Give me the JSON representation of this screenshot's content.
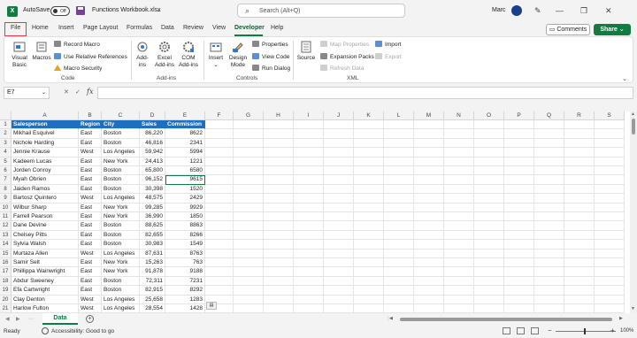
{
  "titlebar": {
    "autosave_label": "AutoSave",
    "autosave_state": "Off",
    "document_title": "Functions Workbook.xlsx",
    "search_placeholder": "Search (Alt+Q)",
    "user_name": "Marc"
  },
  "tabs": [
    "File",
    "Home",
    "Insert",
    "Page Layout",
    "Formulas",
    "Data",
    "Review",
    "View",
    "Developer",
    "Help"
  ],
  "active_tab": "Developer",
  "actions": {
    "comments": "Comments",
    "share": "Share"
  },
  "ribbon": {
    "code": {
      "label": "Code",
      "visual_basic": "Visual Basic",
      "macros": "Macros",
      "record_macro": "Record Macro",
      "use_relative": "Use Relative References",
      "macro_security": "Macro Security"
    },
    "addins": {
      "label": "Add-ins",
      "addins": "Add-ins",
      "excel_addins": "Excel Add-ins",
      "com_addins": "COM Add-ins"
    },
    "controls": {
      "label": "Controls",
      "insert": "Insert",
      "design_mode": "Design Mode",
      "properties": "Properties",
      "view_code": "View Code",
      "run_dialog": "Run Dialog"
    },
    "xml": {
      "label": "XML",
      "source": "Source",
      "map_properties": "Map Properties",
      "expansion_packs": "Expansion Packs",
      "refresh_data": "Refresh Data",
      "import": "Import",
      "export": "Export"
    }
  },
  "formula_bar": {
    "name_box": "E7",
    "formula": ""
  },
  "columns": [
    "A",
    "B",
    "C",
    "D",
    "E",
    "F",
    "G",
    "H",
    "I",
    "J",
    "K",
    "L",
    "M",
    "N",
    "O",
    "P",
    "Q",
    "R",
    "S"
  ],
  "table": {
    "headers": [
      "Salesperson",
      "Region",
      "City",
      "Sales",
      "Commission"
    ],
    "rows": [
      [
        "Mikhail Esquivel",
        "East",
        "Boston",
        "86,220",
        "8622"
      ],
      [
        "Nichole Harding",
        "East",
        "Boston",
        "46,816",
        "2341"
      ],
      [
        "Jennie Krause",
        "West",
        "Los Angeles",
        "59,942",
        "5994"
      ],
      [
        "Kadeem Lucas",
        "East",
        "New York",
        "24,413",
        "1221"
      ],
      [
        "Jorden Conroy",
        "East",
        "Boston",
        "65,800",
        "6580"
      ],
      [
        "Myah Obrien",
        "East",
        "Boston",
        "96,152",
        "9615"
      ],
      [
        "Jaiden Ramos",
        "East",
        "Boston",
        "30,398",
        "1520"
      ],
      [
        "Bartosz Quintero",
        "West",
        "Los Angeles",
        "48,575",
        "2429"
      ],
      [
        "Wilbur Sharp",
        "East",
        "New York",
        "99,285",
        "9929"
      ],
      [
        "Farrell Pearson",
        "East",
        "New York",
        "36,990",
        "1850"
      ],
      [
        "Dane Devine",
        "East",
        "Boston",
        "88,625",
        "8863"
      ],
      [
        "Chelsey Pitts",
        "East",
        "Boston",
        "82,655",
        "8266"
      ],
      [
        "Sylvia Walsh",
        "East",
        "Boston",
        "30,983",
        "1549"
      ],
      [
        "Murtaza Allen",
        "West",
        "Los Angeles",
        "87,631",
        "8763"
      ],
      [
        "Samir Selt",
        "East",
        "New York",
        "15,263",
        "763"
      ],
      [
        "Phillippa Wainwright",
        "East",
        "New York",
        "91,878",
        "9188"
      ],
      [
        "Abdur Sweeney",
        "East",
        "Boston",
        "72,311",
        "7231"
      ],
      [
        "Efa Cartwright",
        "East",
        "Boston",
        "82,915",
        "8292"
      ],
      [
        "Clay Denton",
        "West",
        "Los Angeles",
        "25,658",
        "1283"
      ],
      [
        "Harlow Fulton",
        "West",
        "Los Angeles",
        "28,554",
        "1428"
      ]
    ]
  },
  "sheet": {
    "name": "Data"
  },
  "status": {
    "ready": "Ready",
    "accessibility": "Accessibility: Good to go",
    "zoom": "100%"
  }
}
